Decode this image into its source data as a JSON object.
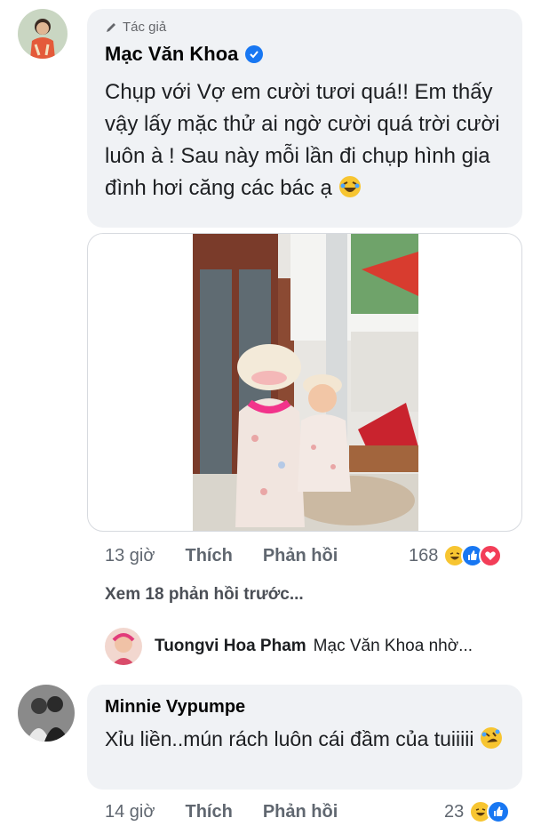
{
  "comment1": {
    "author_tag": "Tác giả",
    "author_name": "Mạc Văn Khoa",
    "text": "Chụp với Vợ em cười tươi quá!! Em thấy vậy lấy mặc thử ai ngờ cười quá trời cười luôn à ! Sau này mỗi lần đi chụp hình gia đình hơi căng các bác ạ",
    "time": "13 giờ",
    "like_label": "Thích",
    "reply_label": "Phản hồi",
    "reaction_count": "168",
    "reactions": [
      "haha-icon",
      "like-icon",
      "love-icon"
    ]
  },
  "view_more": "Xem 18 phản hồi trước...",
  "reply_preview": {
    "name": "Tuongvi Hoa Pham",
    "text": "Mạc Văn Khoa nhờ..."
  },
  "comment2": {
    "author_name": "Minnie Vypumpe",
    "text": "Xỉu liền..mún rách luôn cái đầm của tuiiiii",
    "time": "14 giờ",
    "like_label": "Thích",
    "reply_label": "Phản hồi",
    "reaction_count": "23",
    "reactions": [
      "haha-icon",
      "like-icon"
    ]
  },
  "colors": {
    "bubble": "#f0f2f5",
    "verified": "#1877f2",
    "meta_text": "#606770"
  }
}
